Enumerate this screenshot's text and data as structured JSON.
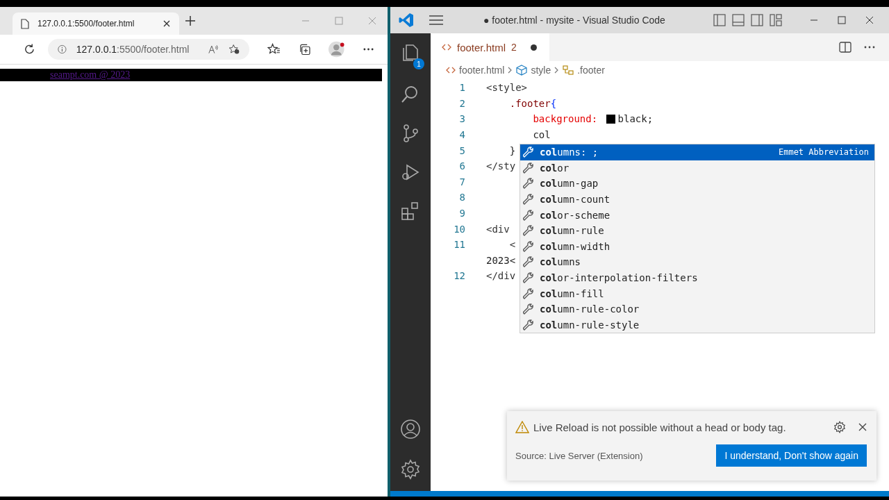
{
  "browser": {
    "tab": {
      "title": "127.0.0.1:5500/footer.html"
    },
    "address": {
      "host": "127.0.0.1",
      "rest": ":5500/footer.html"
    },
    "page": {
      "footer_link": "seampt.com @ 2023"
    }
  },
  "vscode": {
    "title": "● footer.html - mysite - Visual Studio Code",
    "activity_badge": "1",
    "tab": {
      "name": "footer.html",
      "problems": "2",
      "modified": true
    },
    "breadcrumbs": [
      {
        "kind": "file",
        "text": "footer.html"
      },
      {
        "kind": "element",
        "text": "style"
      },
      {
        "kind": "selector",
        "text": ".footer"
      }
    ],
    "code_lines": [
      {
        "number": "1",
        "tokens": [
          {
            "kind": "tag",
            "text": "<style>"
          }
        ]
      },
      {
        "number": "2",
        "tokens": [
          {
            "kind": "selector",
            "text": "    .footer"
          },
          {
            "kind": "brace",
            "text": "{"
          }
        ]
      },
      {
        "number": "3",
        "tokens": [
          {
            "kind": "property",
            "text": "        background: "
          },
          {
            "kind": "swatch",
            "color": "#000000"
          },
          {
            "kind": "plain",
            "text": "black;"
          }
        ]
      },
      {
        "number": "4",
        "tokens": [
          {
            "kind": "plain",
            "text": "        col"
          }
        ]
      },
      {
        "number": "5",
        "tokens": [
          {
            "kind": "plain",
            "text": "    }"
          }
        ]
      },
      {
        "number": "6",
        "tokens": [
          {
            "kind": "tag",
            "text": "</sty"
          }
        ]
      },
      {
        "number": "7"
      },
      {
        "number": "8"
      },
      {
        "number": "9"
      },
      {
        "number": "10",
        "tokens": [
          {
            "kind": "tag",
            "text": "<div"
          }
        ]
      },
      {
        "number": "11",
        "tokens": [
          {
            "kind": "tag",
            "text": "    <"
          }
        ]
      },
      {
        "tokens": [
          {
            "kind": "plain",
            "text": "2023<"
          }
        ]
      },
      {
        "number": "12",
        "tokens": [
          {
            "kind": "tag",
            "text": "</div"
          }
        ]
      }
    ],
    "suggestions": [
      {
        "text": "**col**umns: ;",
        "selected": true,
        "detail": "Emmet Abbreviation"
      },
      {
        "text": "**col**or",
        "selected": false
      },
      {
        "text": "**col**umn-gap",
        "selected": false
      },
      {
        "text": "**col**umn-count",
        "selected": false
      },
      {
        "text": "**col**or-scheme",
        "selected": false
      },
      {
        "text": "**col**umn-rule",
        "selected": false
      },
      {
        "text": "**col**umn-width",
        "selected": false
      },
      {
        "text": "**col**umns",
        "selected": false
      },
      {
        "text": "**col**or-interpolation-filters",
        "selected": false
      },
      {
        "text": "**col**umn-fill",
        "selected": false
      },
      {
        "text": "**col**umn-rule-color",
        "selected": false
      },
      {
        "text": "**col**umn-rule-style",
        "selected": false
      }
    ],
    "notification": {
      "message": "Live Reload is not possible without a head or body tag.",
      "source": "Source: Live Server (Extension)",
      "button": "I understand, Don't show again"
    }
  }
}
